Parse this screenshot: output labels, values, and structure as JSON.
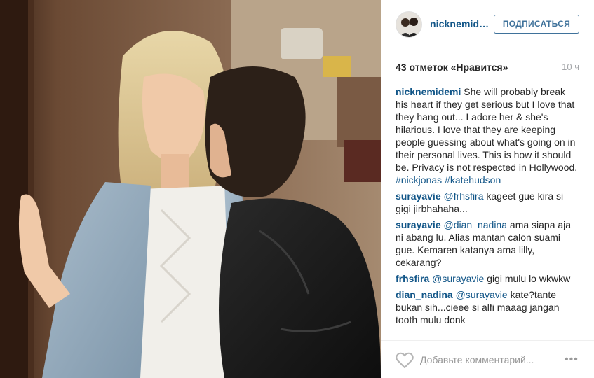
{
  "post": {
    "username": "nicknemid…",
    "follow_label": "ПОДПИСАТЬСЯ",
    "likes_text": "43 отметок «Нравится»",
    "time_ago": "10 ч"
  },
  "caption": {
    "user": "nicknemidemi",
    "text": "She will probably break his heart if they get serious but I love that they hang out... I adore her & she's hilarious. I love that they are keeping people guessing about what's going on in their personal lives. This is how it should be. Privacy is not respected in Hollywood.",
    "hashtags": [
      "#nickjonas",
      "#katehudson"
    ]
  },
  "comments": [
    {
      "user": "surayavie",
      "mention": "@frhsfira",
      "text": "kageet gue kira si gigi jirbhahaha..."
    },
    {
      "user": "surayavie",
      "mention": "@dian_nadina",
      "text": "ama siapa aja ni abang lu. Alias mantan calon suami gue. Kemaren katanya ama lilly, cekarang?"
    },
    {
      "user": "frhsfira",
      "mention": "@surayavie",
      "text": "gigi mulu lo wkwkw"
    },
    {
      "user": "dian_nadina",
      "mention": "@surayavie",
      "text": "kate?tante bukan sih...cieee si alfi maaag jangan tooth mulu donk"
    }
  ],
  "footer": {
    "comment_placeholder": "Добавьте комментарий...",
    "more_label": "•••"
  },
  "icons": {
    "like": "heart-outline-icon",
    "more": "ellipsis-icon"
  },
  "colors": {
    "link": "#125688",
    "button": "#3f729b",
    "muted": "#a5a7aa"
  }
}
